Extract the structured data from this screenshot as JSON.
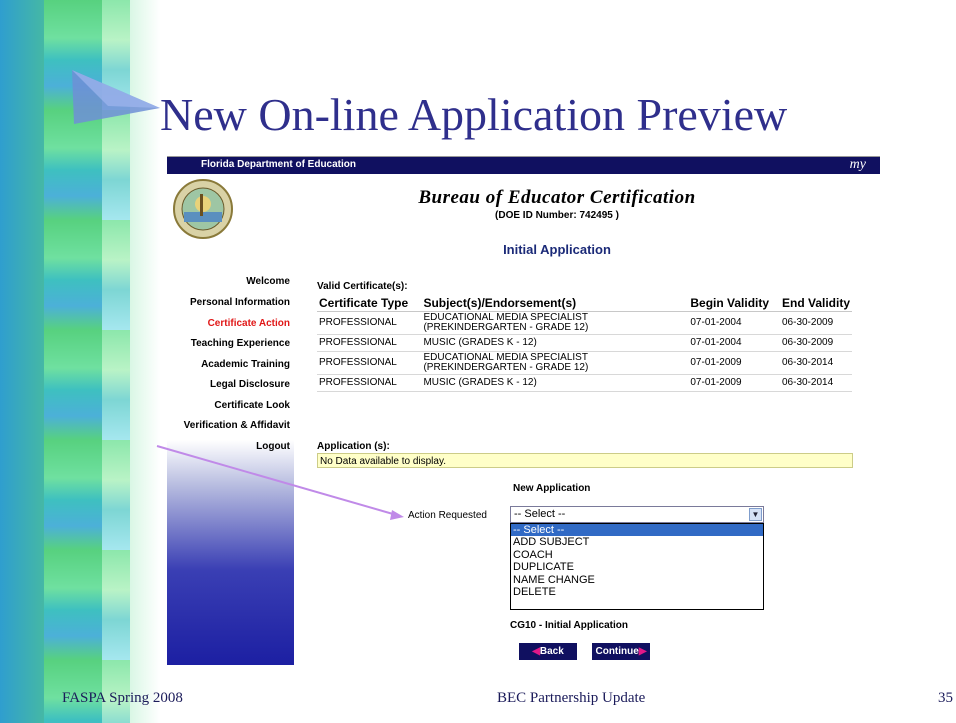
{
  "slide": {
    "title": "New On-line Application Preview",
    "footer_left": "FASPA Spring 2008",
    "footer_center": "BEC Partnership Update",
    "footer_right": "35"
  },
  "banner": {
    "org": "Florida Department of Education",
    "brand": "my"
  },
  "header": {
    "title": "Bureau of Educator Certification",
    "doe_id": "(DOE ID Number: 742495 )",
    "subtitle": "Initial Application"
  },
  "nav": {
    "items": [
      {
        "label": "Welcome"
      },
      {
        "label": "Personal Information"
      },
      {
        "label": "Certificate Action"
      },
      {
        "label": "Teaching Experience"
      },
      {
        "label": "Academic Training"
      },
      {
        "label": "Legal Disclosure"
      },
      {
        "label": "Certificate Look"
      },
      {
        "label": "Verification & Affidavit"
      },
      {
        "label": "Logout"
      }
    ]
  },
  "certificates": {
    "label": "Valid Certificate(s):",
    "headers": [
      "Certificate Type",
      "Subject(s)/Endorsement(s)",
      "Begin Validity",
      "End Validity"
    ],
    "rows": [
      {
        "type": "PROFESSIONAL",
        "subject_l1": "EDUCATIONAL MEDIA SPECIALIST",
        "subject_l2": "(PREKINDERGARTEN - GRADE 12)",
        "begin": "07-01-2004",
        "end": "06-30-2009"
      },
      {
        "type": "PROFESSIONAL",
        "subject_l1": "MUSIC (GRADES K - 12)",
        "subject_l2": "",
        "begin": "07-01-2004",
        "end": "06-30-2009"
      },
      {
        "type": "PROFESSIONAL",
        "subject_l1": "EDUCATIONAL MEDIA SPECIALIST",
        "subject_l2": "(PREKINDERGARTEN - GRADE 12)",
        "begin": "07-01-2009",
        "end": "06-30-2014"
      },
      {
        "type": "PROFESSIONAL",
        "subject_l1": "MUSIC (GRADES K - 12)",
        "subject_l2": "",
        "begin": "07-01-2009",
        "end": "06-30-2014"
      }
    ]
  },
  "applications": {
    "label": "Application (s):",
    "empty_text": "No Data available to display."
  },
  "new_application": {
    "heading": "New Application",
    "action_label": "Action Requested",
    "selected": "-- Select --",
    "options": [
      "-- Select --",
      "ADD SUBJECT",
      "COACH",
      "DUPLICATE",
      "NAME CHANGE",
      "DELETE"
    ],
    "form_code": "CG10 - Initial Application",
    "back_label": "Back",
    "continue_label": "Continue"
  },
  "colors": {
    "title_blue": "#2f2f8c",
    "banner_navy": "#101060",
    "active_red": "#e01818",
    "selection_blue": "#316ac5",
    "pointer_violet": "#c08ae8"
  }
}
